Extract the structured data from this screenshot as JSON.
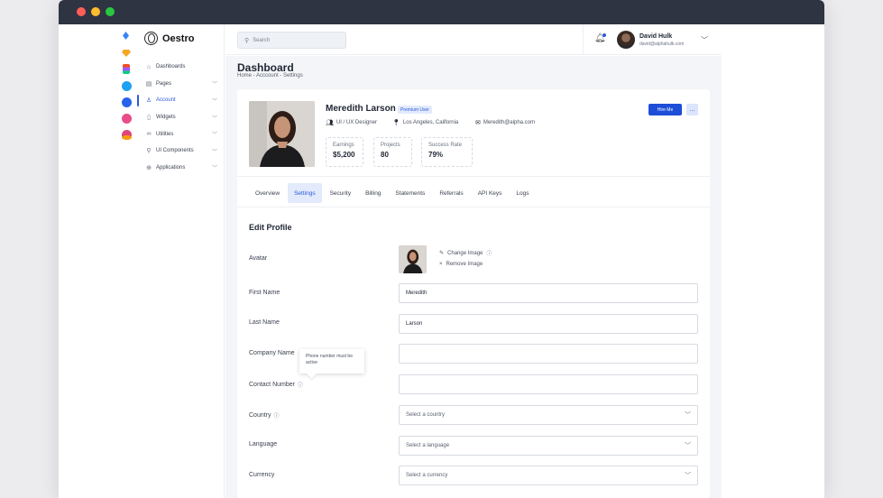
{
  "topbar": {
    "search_placeholder": "Search",
    "user_name": "David Hulk",
    "user_email": "david@alphahulk.com"
  },
  "sidebar": {
    "app_name": "Oestro",
    "items": [
      {
        "label": "Dashboards",
        "icon": "home-icon"
      },
      {
        "label": "Pages",
        "icon": "pages-icon"
      },
      {
        "label": "Account",
        "icon": "user-icon"
      },
      {
        "label": "Widgets",
        "icon": "bookmark-icon"
      },
      {
        "label": "Utilities",
        "icon": "utilities-icon"
      },
      {
        "label": "UI Components",
        "icon": "components-icon"
      },
      {
        "label": "Applications",
        "icon": "applications-icon"
      }
    ]
  },
  "header": {
    "title": "Dashboard",
    "breadcrumb": "Home - Acccount - Settings"
  },
  "profile": {
    "name": "Meredith Larson",
    "badge": "Premium User",
    "role": "UI / UX Designer",
    "location": "Los Angeles, California",
    "email": "Meredith@alpha.com",
    "stats": [
      {
        "label": "Earnings",
        "value": "$5,200"
      },
      {
        "label": "Projects",
        "value": "80"
      },
      {
        "label": "Success Rate",
        "value": "79%"
      }
    ],
    "hire_label": "Hire Me",
    "more_label": "..."
  },
  "tabs": [
    "Overview",
    "Settings",
    "Security",
    "Billing",
    "Statements",
    "Referrals",
    "API Keys",
    "Logs"
  ],
  "form": {
    "title": "Edit Profile",
    "avatar_label": "Avatar",
    "change_image": "Change Image",
    "remove_image": "Remove Image",
    "first_name_label": "First Name",
    "first_name_value": "Meredith",
    "last_name_label": "Last Name",
    "last_name_value": "Larson",
    "company_label": "Company Name",
    "company_value": "",
    "contact_label": "Contact Number",
    "contact_value": "",
    "tooltip": "Phone number must be active",
    "country_label": "Country",
    "country_value": "Select a country",
    "language_label": "Language",
    "language_value": "Select a language",
    "currency_label": "Currency",
    "currency_value": "Select a currency"
  },
  "colors": {
    "accent": "#1d4ed8",
    "titlebar": "#2e3442"
  }
}
